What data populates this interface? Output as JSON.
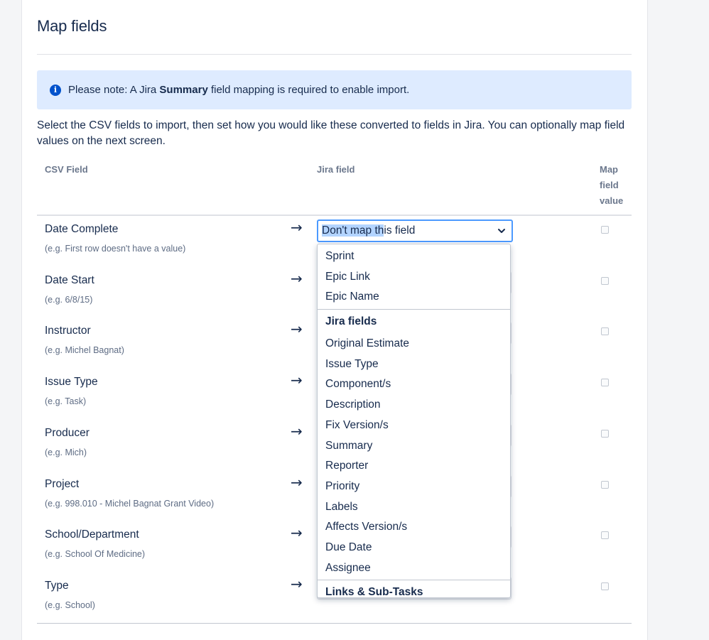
{
  "page": {
    "title": "Map fields"
  },
  "notice": {
    "prefix": "Please note: A Jira ",
    "bold": "Summary",
    "suffix": " field mapping is required to enable import."
  },
  "intro": "Select the CSV fields to import, then set how you would like these converted to fields in Jira. You can optionally map field values on the next screen.",
  "columns": {
    "csv_field": "CSV Field",
    "jira_field": "Jira field",
    "map_field_value": "Map field value"
  },
  "rows": [
    {
      "name": "Date Complete",
      "example": "(e.g.  First row doesn't have a value)"
    },
    {
      "name": "Date Start",
      "example": "(e.g.  6/8/15)"
    },
    {
      "name": "Instructor",
      "example": "(e.g.  Michel Bagnat)"
    },
    {
      "name": "Issue Type",
      "example": "(e.g.  Task)"
    },
    {
      "name": "Producer",
      "example": "(e.g.  Mich)"
    },
    {
      "name": "Project",
      "example": "(e.g.  998.010 - Michel Bagnat Grant Video)"
    },
    {
      "name": "School/Department",
      "example": "(e.g.  School Of Medicine)"
    },
    {
      "name": "Type",
      "example": "(e.g.  School)"
    }
  ],
  "arrow_glyph": "→",
  "active_select": {
    "value_highlighted": "Don't map th",
    "value_rest": "is field"
  },
  "dropdown": {
    "top_items": [
      "Sprint",
      "Epic Link",
      "Epic Name"
    ],
    "jira_fields_group": "Jira fields",
    "jira_fields": [
      "Original Estimate",
      "Issue Type",
      "Component/s",
      "Description",
      "Fix Version/s",
      "Summary",
      "Reporter",
      "Priority",
      "Labels",
      "Affects Version/s",
      "Due Date",
      "Assignee"
    ],
    "links_group": "Links & Sub-Tasks"
  },
  "colors": {
    "info_bg": "#deebff",
    "info_icon": "#0052cc",
    "focus_border": "#4c9aff",
    "text": "#172b4d",
    "muted": "#6b778c"
  }
}
